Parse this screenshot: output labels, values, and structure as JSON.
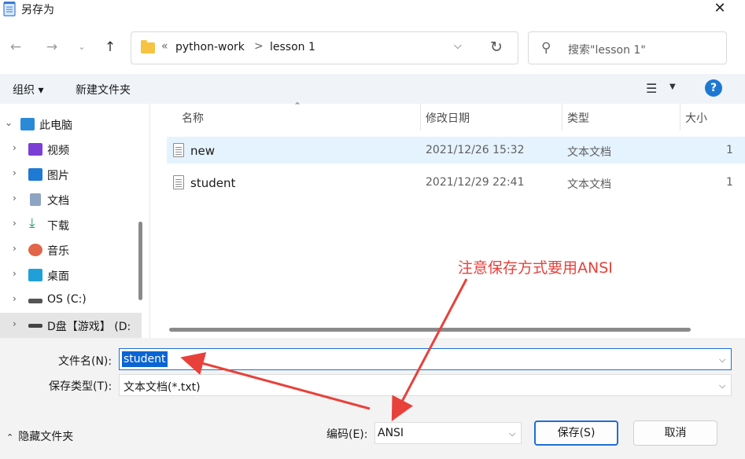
{
  "window": {
    "title": "另存为"
  },
  "address": {
    "overflow": "«",
    "path": [
      "python-work",
      "lesson 1"
    ],
    "separator": ">"
  },
  "search": {
    "placeholder": "搜索\"lesson 1\""
  },
  "toolbar": {
    "organize": "组织 ▾",
    "new_folder": "新建文件夹",
    "help": "?"
  },
  "sidebar": {
    "items": [
      {
        "label": "此电脑",
        "expanded": true,
        "icon": "computer-icon"
      },
      {
        "label": "视频",
        "icon": "video-icon"
      },
      {
        "label": "图片",
        "icon": "pictures-icon"
      },
      {
        "label": "文档",
        "icon": "documents-icon"
      },
      {
        "label": "下载",
        "icon": "download-icon"
      },
      {
        "label": "音乐",
        "icon": "music-icon"
      },
      {
        "label": "桌面",
        "icon": "desktop-icon"
      },
      {
        "label": "OS (C:)",
        "icon": "drive-icon"
      },
      {
        "label": "D盘【游戏】 (D:",
        "icon": "drive-icon",
        "selected": true
      }
    ]
  },
  "columns": {
    "name": "名称",
    "modified": "修改日期",
    "type": "类型",
    "size": "大小"
  },
  "files": [
    {
      "name": "new",
      "modified": "2021/12/26 15:32",
      "type": "文本文档",
      "size": "1",
      "selected": true
    },
    {
      "name": "student",
      "modified": "2021/12/29 22:41",
      "type": "文本文档",
      "size": "1"
    }
  ],
  "annotation": {
    "text": "注意保存方式要用ANSI",
    "color": "#e8413b"
  },
  "form": {
    "filename_label": "文件名(N):",
    "filename_value": "student",
    "filetype_label": "保存类型(T):",
    "filetype_value": "文本文档(*.txt)",
    "encoding_label": "编码(E):",
    "encoding_value": "ANSI"
  },
  "footer": {
    "hide_folders": "隐藏文件夹",
    "save": "保存(S)",
    "cancel": "取消"
  },
  "colors": {
    "accent": "#1e6fd6",
    "selection": "#e5f3ff",
    "toolbar_bg": "#f0f4f9"
  }
}
